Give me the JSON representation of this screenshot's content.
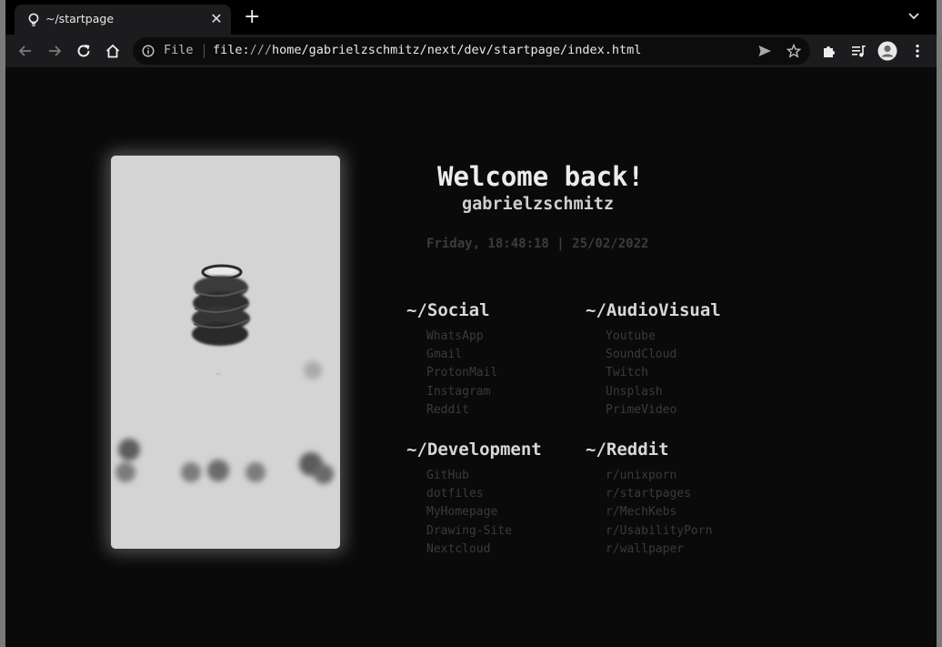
{
  "browser": {
    "tab_title": "~/startpage",
    "tab_close": "✕",
    "new_tab": "+",
    "address": {
      "scheme_label": "File",
      "url_prefix": "file:",
      "url_slashes": "///",
      "url_path": "home/gabrielzschmitz/next/dev/startpage/index.html"
    }
  },
  "page": {
    "greeting": "Welcome back!",
    "username": "gabrielzschmitz",
    "datetime": "Friday, 18:48:18 | 25/02/2022",
    "groups": [
      {
        "title": "~/Social",
        "links": [
          "WhatsApp",
          "Gmail",
          "ProtonMail",
          "Instagram",
          "Reddit"
        ]
      },
      {
        "title": "~/AudioVisual",
        "links": [
          "Youtube",
          "SoundCloud",
          "Twitch",
          "Unsplash",
          "PrimeVideo"
        ]
      },
      {
        "title": "~/Development",
        "links": [
          "GitHub",
          "dotfiles",
          "MyHomepage",
          "Drawing-Site",
          "Nextcloud"
        ]
      },
      {
        "title": "~/Reddit",
        "links": [
          "r/unixporn",
          "r/startpages",
          "r/MechKebs",
          "r/UsabilityPorn",
          "r/wallpaper"
        ]
      }
    ]
  }
}
